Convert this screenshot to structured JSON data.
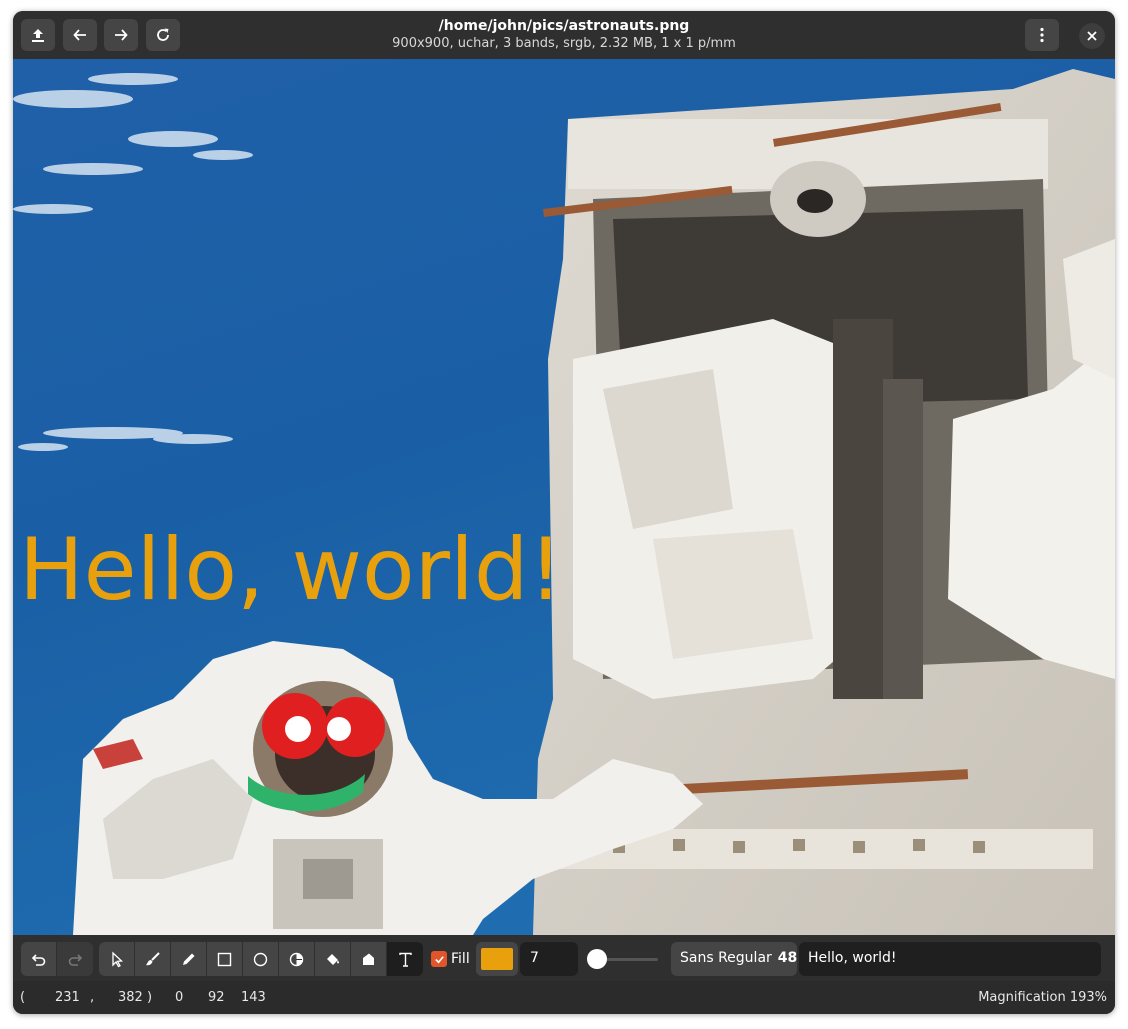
{
  "header": {
    "title": "/home/john/pics/astronauts.png",
    "subtitle": "900x900,  uchar, 3 bands, srgb, 2.32 MB, 1 x 1 p/mm",
    "buttons": [
      "upload-icon",
      "arrow-left-icon",
      "arrow-right-icon",
      "refresh-icon",
      "kebab-menu-icon",
      "close-icon"
    ]
  },
  "canvas": {
    "overlay_text": "Hello, world!",
    "overlay_color": "#e8a10c",
    "annotation_colors": {
      "eyes": "#e02020",
      "pupils": "#ffffff",
      "smile": "#2fb36b"
    }
  },
  "toolbar": {
    "tools": [
      "undo-icon",
      "redo-icon",
      "select-icon",
      "brush-icon",
      "pencil-icon",
      "rectangle-icon",
      "circle-icon",
      "contrast-icon",
      "flood-fill-icon",
      "bucket-icon",
      "text-icon"
    ],
    "active_tool": "text-icon",
    "fill_label": "Fill",
    "fill_checked": true,
    "color": "#e8a10c",
    "line_width": "7",
    "font_name": "Sans Regular",
    "font_size": "48",
    "text_value": "Hello, world!"
  },
  "status": {
    "coord_open": "(",
    "coord_x": "231",
    "coord_sep": ",",
    "coord_y": "382",
    "coord_close": ")",
    "pixel_r": "0",
    "pixel_g": "92",
    "pixel_b": "143",
    "magnification": "Magnification 193%"
  },
  "colors": {
    "accent": "#e0562a",
    "window_bg": "#2b2b2b",
    "button_bg": "#454545"
  }
}
